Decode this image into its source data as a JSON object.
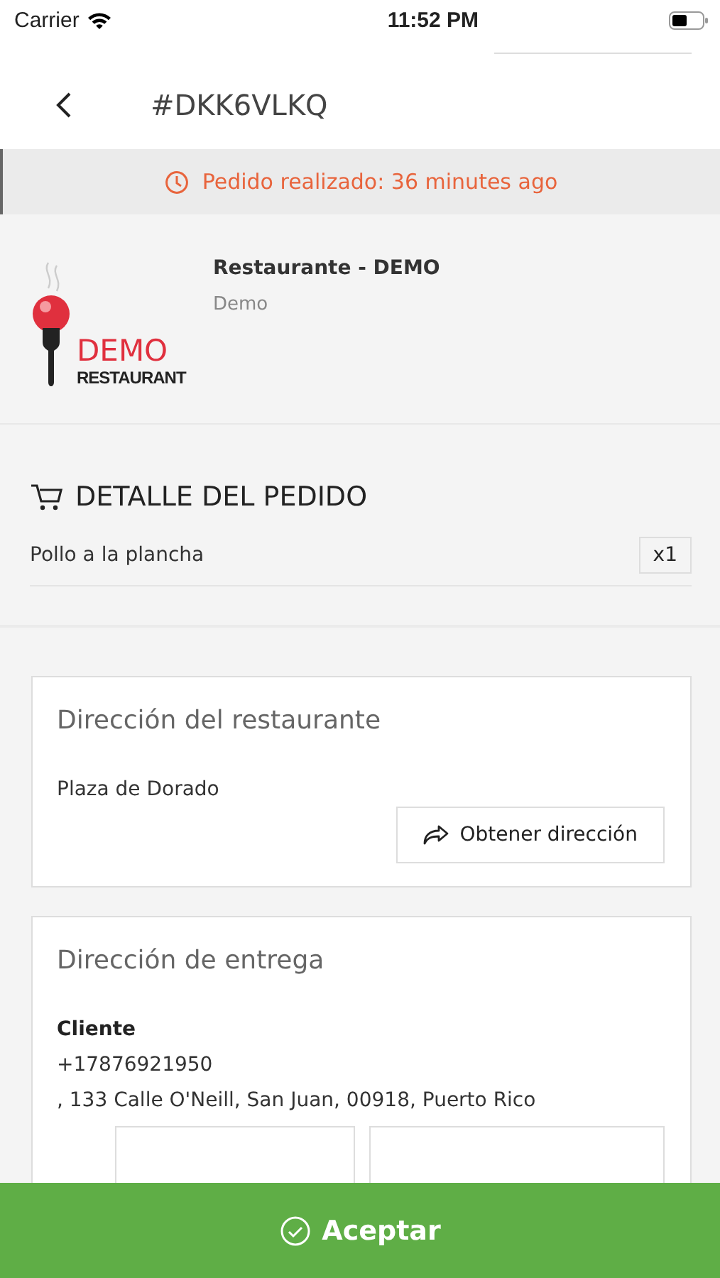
{
  "status_bar": {
    "carrier": "Carrier",
    "time": "11:52 PM"
  },
  "header": {
    "title": "#DKK6VLKQ"
  },
  "banner": {
    "text": "Pedido realizado: 36 minutes ago"
  },
  "restaurant": {
    "logo_text": "DEMO",
    "logo_subtext": "RESTAURANT",
    "name": "Restaurante - DEMO",
    "subtitle": "Demo"
  },
  "order": {
    "title": "DETALLE DEL PEDIDO",
    "items": [
      {
        "name": "Pollo a la plancha",
        "quantity": "x1"
      }
    ]
  },
  "restaurant_address": {
    "title": "Dirección del restaurante",
    "address": "Plaza de Dorado",
    "button": "Obtener dirección"
  },
  "delivery_address": {
    "title": "Dirección de entrega",
    "customer_label": "Cliente",
    "phone": "+17876921950",
    "address": ", 133 Calle O'Neill, San Juan, 00918, Puerto Rico"
  },
  "accept_button": {
    "label": "Aceptar"
  }
}
